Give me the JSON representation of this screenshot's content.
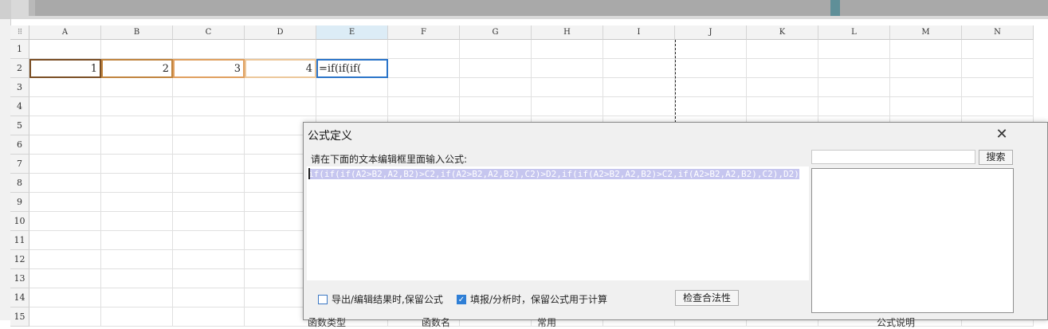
{
  "spreadsheet": {
    "columns": [
      "A",
      "B",
      "C",
      "D",
      "E",
      "F",
      "G",
      "H",
      "I",
      "J",
      "K",
      "L",
      "M",
      "N"
    ],
    "rows": [
      "1",
      "2",
      "3",
      "4",
      "5",
      "6",
      "7",
      "8",
      "9",
      "10",
      "11",
      "12",
      "13",
      "14",
      "15"
    ],
    "cells": {
      "A2": "1",
      "B2": "2",
      "C2": "3",
      "D2": "4",
      "E2": "=if(if(if("
    }
  },
  "dialog": {
    "title": "公式定义",
    "close_icon": "close-icon",
    "prompt": "请在下面的文本编辑框里面输入公式:",
    "formula": "if(if(if(A2>B2,A2,B2)>C2,if(A2>B2,A2,B2),C2)>D2,if(if(A2>B2,A2,B2)>C2,if(A2>B2,A2,B2),C2),D2)",
    "checkbox_export_label": "导出/编辑结果时,保留公式",
    "checkbox_export_checked": false,
    "checkbox_fill_label": "填报/分析时，保留公式用于计算",
    "checkbox_fill_checked": true,
    "check_button": "检查合法性",
    "search_button": "搜索",
    "search_value": "",
    "bottom_labels": [
      "函数类型",
      "函数名",
      "常用",
      "公式说明"
    ]
  },
  "colors": {
    "active_cell_border": "#2a74c9",
    "selection_highlight": "#c6c6ef",
    "checkbox_checked": "#2f7fd6"
  }
}
